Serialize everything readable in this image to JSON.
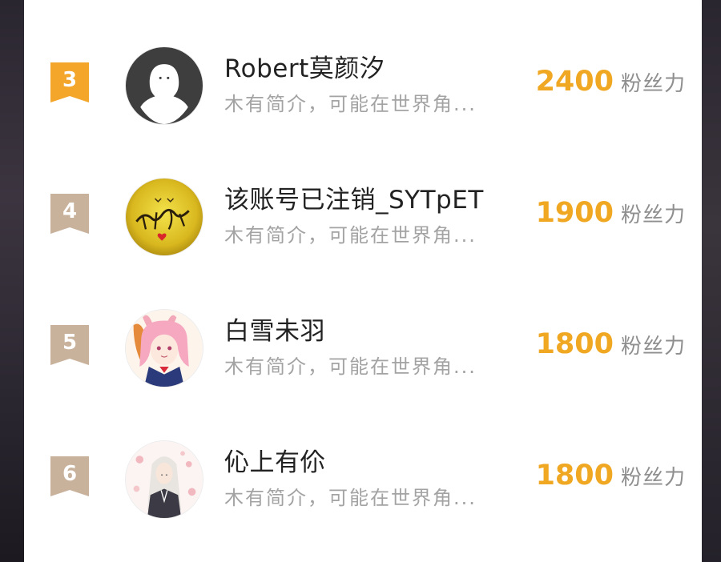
{
  "ranking": {
    "items": [
      {
        "rank": "3",
        "name": "Robert莫颜汐",
        "bio": "木有简介，可能在世界角...",
        "score": "2400",
        "unit": "粉丝力",
        "avatar": "ghost-avatar"
      },
      {
        "rank": "4",
        "name": "该账号已注销_SYTpET",
        "bio": "木有简介，可能在世界角...",
        "score": "1900",
        "unit": "粉丝力",
        "avatar": "calligraphy-avatar"
      },
      {
        "rank": "5",
        "name": "白雪未羽",
        "bio": "木有简介，可能在世界角...",
        "score": "1800",
        "unit": "粉丝力",
        "avatar": "anime-girl-avatar"
      },
      {
        "rank": "6",
        "name": "伈上有伱",
        "bio": "木有简介，可能在世界角...",
        "score": "1800",
        "unit": "粉丝力",
        "avatar": "anime-character-avatar"
      }
    ]
  },
  "colors": {
    "rank_gold": "#f3a62a",
    "rank_tan": "#c9b29b",
    "score": "#f0a722"
  }
}
